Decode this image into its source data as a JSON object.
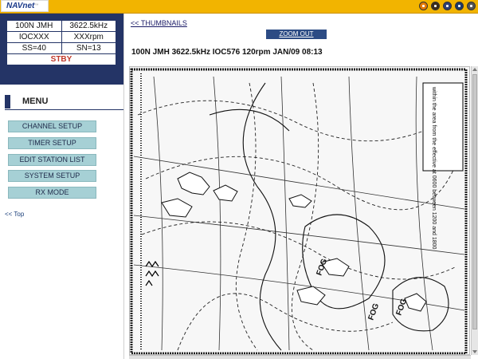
{
  "app": {
    "logo": "NAVnet",
    "logo_sub": "™",
    "top_icons": [
      "alert-icon",
      "pointer-icon",
      "folder-icon",
      "mail-icon",
      "settings-icon"
    ]
  },
  "status": {
    "rows": [
      [
        "100N JMH",
        "3622.5kHz"
      ],
      [
        "IOCXXX",
        "XXXrpm"
      ],
      [
        "SS=40",
        "SN=13"
      ]
    ],
    "state": "STBY"
  },
  "menu": {
    "title": "MENU",
    "items": [
      "CHANNEL SETUP",
      "TIMER SETUP",
      "EDIT STATION LIST",
      "SYSTEM SETUP",
      "RX MODE"
    ],
    "top_link": "<< Top"
  },
  "main": {
    "thumbnails_link": "<< THUMBNAILS",
    "zoom_out": "ZOOM OUT",
    "fax_title": "100N JMH 3622.5kHz IOC576 120rpm JAN/09 08:13"
  },
  "fax_image": {
    "labels": [
      "FOG",
      "FOG",
      "FOG"
    ],
    "side_note": "within the area from the effective at 0600 between 1200 and 1800"
  },
  "colors": {
    "top_bar": "#f2b400",
    "status_panel": "#243466",
    "menu_button": "#a6d0d5",
    "zoom_button": "#2c4b84",
    "standby_text": "#c0392b"
  }
}
